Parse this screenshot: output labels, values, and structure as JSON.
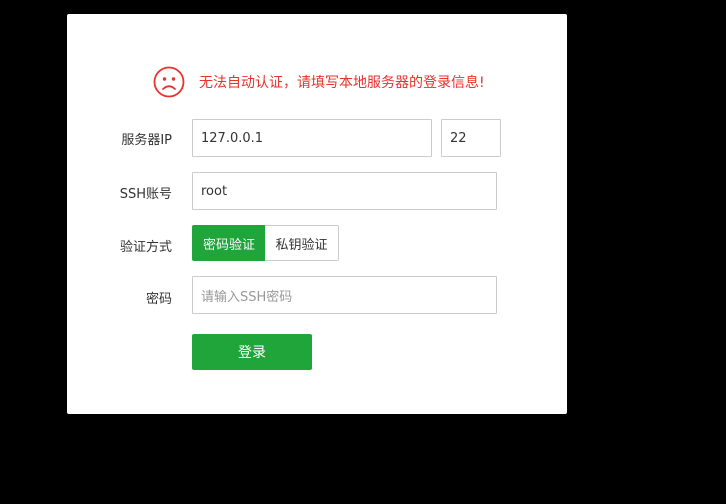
{
  "alert": {
    "icon": "sad-face-icon",
    "message": "无法自动认证，请填写本地服务器的登录信息!",
    "color": "#e8322c"
  },
  "form": {
    "server_ip": {
      "label": "服务器IP",
      "value": "127.0.0.1",
      "port": "22"
    },
    "ssh_account": {
      "label": "SSH账号",
      "value": "root"
    },
    "auth_method": {
      "label": "验证方式",
      "options": [
        "密码验证",
        "私钥验证"
      ],
      "selected": "密码验证"
    },
    "password": {
      "label": "密码",
      "placeholder": "请输入SSH密码"
    },
    "submit_label": "登录"
  },
  "colors": {
    "accent": "#20a53a",
    "error": "#e8322c"
  }
}
